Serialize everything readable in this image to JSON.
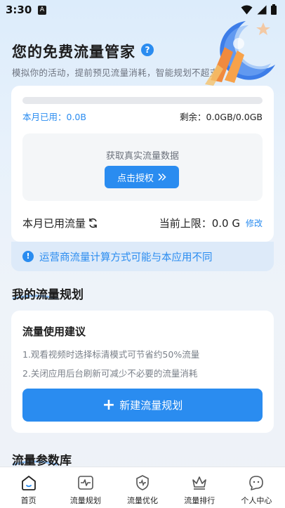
{
  "status_bar": {
    "time": "3:30",
    "app_badge": "A"
  },
  "hero": {
    "title": "您的免费流量管家",
    "subtitle": "模拟你的活动，提前预见流量消耗，智能规划不超支"
  },
  "usage": {
    "used_label": "本月已用：0.0B",
    "remaining_label": "剩余：0.0GB/0.0GB",
    "progress": 0,
    "auth_prompt": "获取真实流量数据",
    "auth_button_label": "点击授权",
    "month_used_label": "本月已用流量",
    "limit_label": "当前上限：0.0 G",
    "edit_label": "修改"
  },
  "notice": {
    "text": "运营商流量计算方式可能与本应用不同"
  },
  "plan_section": {
    "title": "我的流量规划",
    "card_title": "流量使用建议",
    "tips": [
      "1.观看视频时选择标清模式可节省约50%流量",
      "2.关闭应用后台刷新可减少不必要的流量消耗"
    ],
    "new_plan_label": "新建流量规划"
  },
  "library_section": {
    "title": "流量参数库"
  },
  "bottom_nav": [
    {
      "label": "首页",
      "icon": "home-icon"
    },
    {
      "label": "流量规划",
      "icon": "pulse-chart-icon"
    },
    {
      "label": "流量优化",
      "icon": "shield-pulse-icon"
    },
    {
      "label": "流量排行",
      "icon": "crown-icon"
    },
    {
      "label": "个人中心",
      "icon": "user-face-icon"
    }
  ],
  "colors": {
    "accent": "#2a8cf0",
    "notice_bg": "#ddeaf9",
    "card_bg": "#ffffff"
  }
}
